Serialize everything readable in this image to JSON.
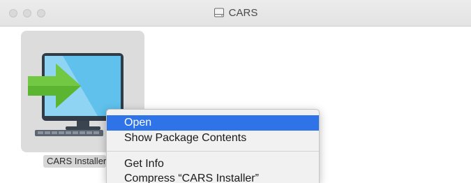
{
  "window": {
    "title": "CARS",
    "title_icon": "disk-icon"
  },
  "file": {
    "label": "CARS Installer",
    "icon": "installer-computer-icon"
  },
  "context_menu": {
    "items": [
      {
        "label": "Open",
        "selected": true
      },
      {
        "label": "Show Package Contents",
        "selected": false
      },
      {
        "label": "Get Info",
        "selected": false
      },
      {
        "label": "Compress “CARS Installer”",
        "selected": false
      }
    ]
  },
  "colors": {
    "selection": "#2e73e8",
    "arrow": "#5cb531",
    "screen": "#5fc1ec"
  }
}
